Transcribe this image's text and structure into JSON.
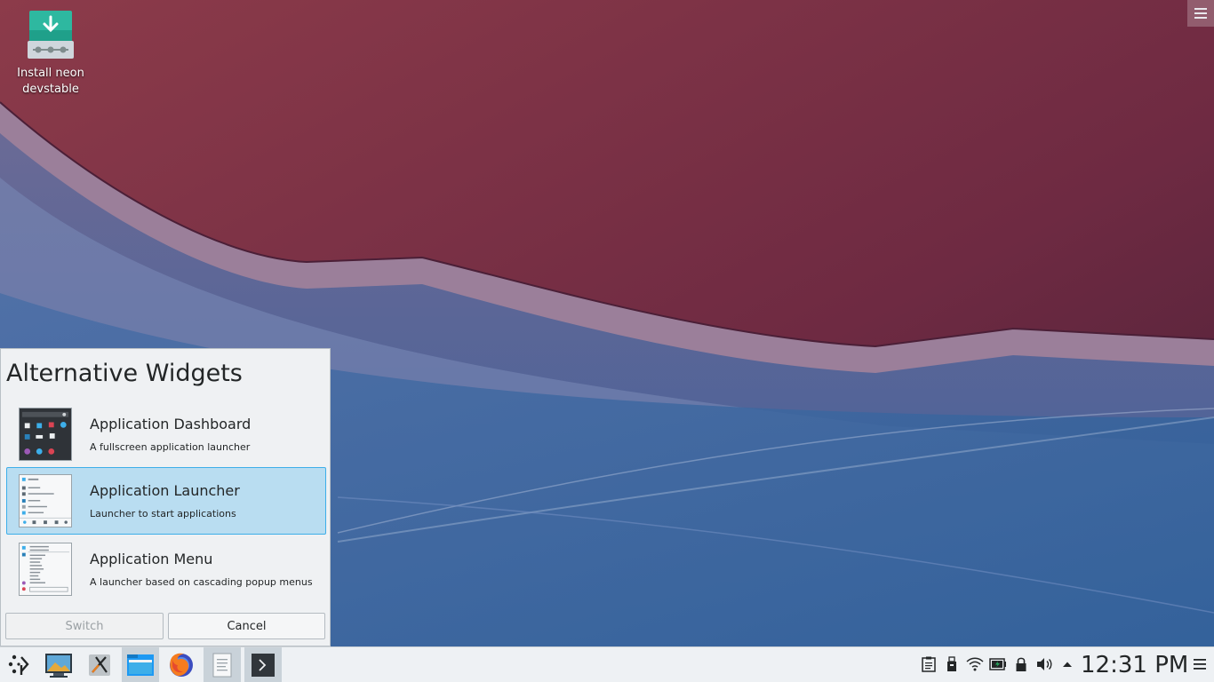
{
  "desktop": {
    "icon_label": "Install neon devstable",
    "icon": "download-installer-icon",
    "toolbox_icon": "hamburger-menu-icon"
  },
  "alternatives": {
    "title": "Alternative Widgets",
    "items": [
      {
        "name": "Application Dashboard",
        "description": "A fullscreen application launcher",
        "icon": "dashboard-thumbnail",
        "selected": false
      },
      {
        "name": "Application Launcher",
        "description": "Launcher to start applications",
        "icon": "launcher-thumbnail",
        "selected": true
      },
      {
        "name": "Application Menu",
        "description": "A launcher based on cascading popup menus",
        "icon": "menu-thumbnail",
        "selected": false
      }
    ],
    "switch_label": "Switch",
    "cancel_label": "Cancel"
  },
  "taskbar": {
    "launcher_icon": "kde-launcher-icon",
    "tasks": [
      {
        "icon": "screenshot-app-icon",
        "active": false
      },
      {
        "icon": "xorg-app-icon",
        "active": false
      },
      {
        "icon": "file-manager-icon",
        "active": true
      },
      {
        "icon": "firefox-icon",
        "active": false
      },
      {
        "icon": "text-editor-icon",
        "active": true
      },
      {
        "icon": "terminal-icon",
        "active": true
      }
    ],
    "tray": [
      "clipboard-icon",
      "usb-device-icon",
      "wifi-icon",
      "battery-icon",
      "lock-icon",
      "volume-icon",
      "expand-tray-icon"
    ],
    "clock": "12:31 PM",
    "menu_icon": "panel-menu-icon"
  },
  "colors": {
    "accent": "#3daee9",
    "selection_bg": "#b9ddf1"
  }
}
